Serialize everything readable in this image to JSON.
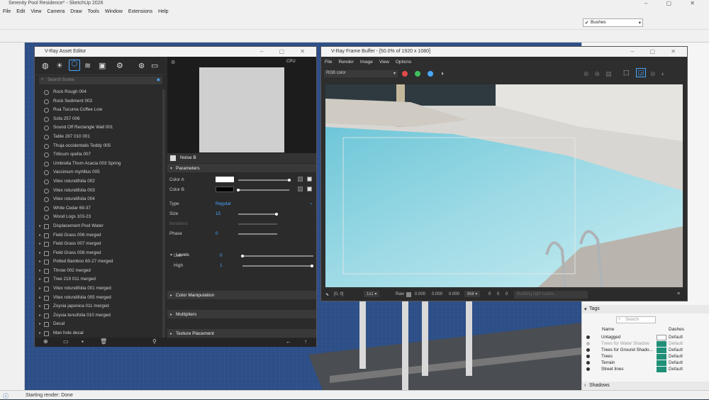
{
  "app": {
    "title": "Serenity Pool Residence* - SketchUp 2026",
    "menu": [
      "File",
      "Edit",
      "View",
      "Camera",
      "Draw",
      "Tools",
      "Window",
      "Extensions",
      "Help"
    ],
    "tag_dropdown": "Bushes"
  },
  "asset_editor": {
    "title": "V-Ray Asset Editor",
    "search_placeholder": "Search Scene",
    "items": [
      {
        "label": "Rock Rough 004",
        "type": "material"
      },
      {
        "label": "Rock Sediment 003",
        "type": "material"
      },
      {
        "label": "Rua Tucuma Coffee Low",
        "type": "material"
      },
      {
        "label": "Sofa 257 006",
        "type": "material"
      },
      {
        "label": "Sound Off Rectangle Wall 001",
        "type": "material"
      },
      {
        "label": "Table 287 010 001",
        "type": "material"
      },
      {
        "label": "Thuja occidentalis Teddy 005",
        "type": "material"
      },
      {
        "label": "Triticum spelta 007",
        "type": "material"
      },
      {
        "label": "Umbrella Thom Acacia 003 Spring",
        "type": "material"
      },
      {
        "label": "Vaccinium myrtillus 005",
        "type": "material"
      },
      {
        "label": "Vitex rotundifolia 002",
        "type": "material"
      },
      {
        "label": "Vitex rotundifolia 003",
        "type": "material"
      },
      {
        "label": "Vitex rotundifolia 004",
        "type": "material"
      },
      {
        "label": "White Cedar 69-37",
        "type": "material"
      },
      {
        "label": "Wood Logs 103-23",
        "type": "material"
      },
      {
        "label": "Displacement Pool Water",
        "type": "group"
      },
      {
        "label": "Field Grass 006 merged",
        "type": "group"
      },
      {
        "label": "Field Grass 007 merged",
        "type": "group"
      },
      {
        "label": "Field Grass 008 merged",
        "type": "group"
      },
      {
        "label": "Potted Bamboo 60-27 merged",
        "type": "group"
      },
      {
        "label": "Throw 002 merged",
        "type": "group"
      },
      {
        "label": "Tree 219 011 merged",
        "type": "group"
      },
      {
        "label": "Vitex rotundifolia 001 merged",
        "type": "group"
      },
      {
        "label": "Vitex rotundifolia 005 merged",
        "type": "group"
      },
      {
        "label": "Zoysia japonica 011 merged",
        "type": "group"
      },
      {
        "label": "Zoysia tenuifolia 010 merged",
        "type": "group"
      },
      {
        "label": "Decal",
        "type": "group"
      },
      {
        "label": "Man hole decal",
        "type": "group"
      }
    ],
    "preview_engine": "CPU",
    "texture_name": "Noise B",
    "sections": {
      "parameters": "Parameters",
      "levels": "Levels",
      "color_manipulation": "Color Manipulation",
      "multipliers": "Multipliers",
      "texture_placement": "Texture Placement"
    },
    "params": {
      "color_a_label": "Color A",
      "color_a": "#ffffff",
      "color_b_label": "Color B",
      "color_b": "#000000",
      "type_label": "Type",
      "type_value": "Regular",
      "size_label": "Size",
      "size_value": "15",
      "iterations_label": "Iterations",
      "phase_label": "Phase",
      "phase_value": "0",
      "low_label": "Low",
      "low_value": "0",
      "high_label": "High",
      "high_value": "1"
    }
  },
  "frame_buffer": {
    "title": "V-Ray Frame Buffer - [50.0% of 1920 x 1080]",
    "menu": [
      "File",
      "Render",
      "Image",
      "View",
      "Options"
    ],
    "channel": "RGB color",
    "coords": "[0, 0]",
    "ratio": "1x1",
    "raw_label": "Raw",
    "rgb_values": [
      "0.000",
      "0.000",
      "0.000"
    ],
    "bit_depth": "8bit",
    "hsv_values": [
      "0",
      "0",
      "0"
    ],
    "status": "Building light cache..."
  },
  "tags_panel": {
    "title": "Tags",
    "search_placeholder": "Search",
    "col_name": "Name",
    "col_dashes": "Dashes",
    "rows": [
      {
        "name": "Untagged",
        "dashes": "Default",
        "color": "#ffffff",
        "dim": false
      },
      {
        "name": "Trees for Water Shadow",
        "dashes": "Default",
        "color": "#1f8f78",
        "dim": true
      },
      {
        "name": "Trees for Ground Shado...",
        "dashes": "Default",
        "color": "#1f8f78",
        "dim": false
      },
      {
        "name": "Trees",
        "dashes": "Default",
        "color": "#1f8f78",
        "dim": false
      },
      {
        "name": "Terrain",
        "dashes": "Default",
        "color": "#1f8f78",
        "dim": false
      },
      {
        "name": "Street lines",
        "dashes": "Default",
        "color": "#1f8f78",
        "dim": false
      }
    ],
    "shadows": "Shadows"
  },
  "status": "Starting render: Done"
}
